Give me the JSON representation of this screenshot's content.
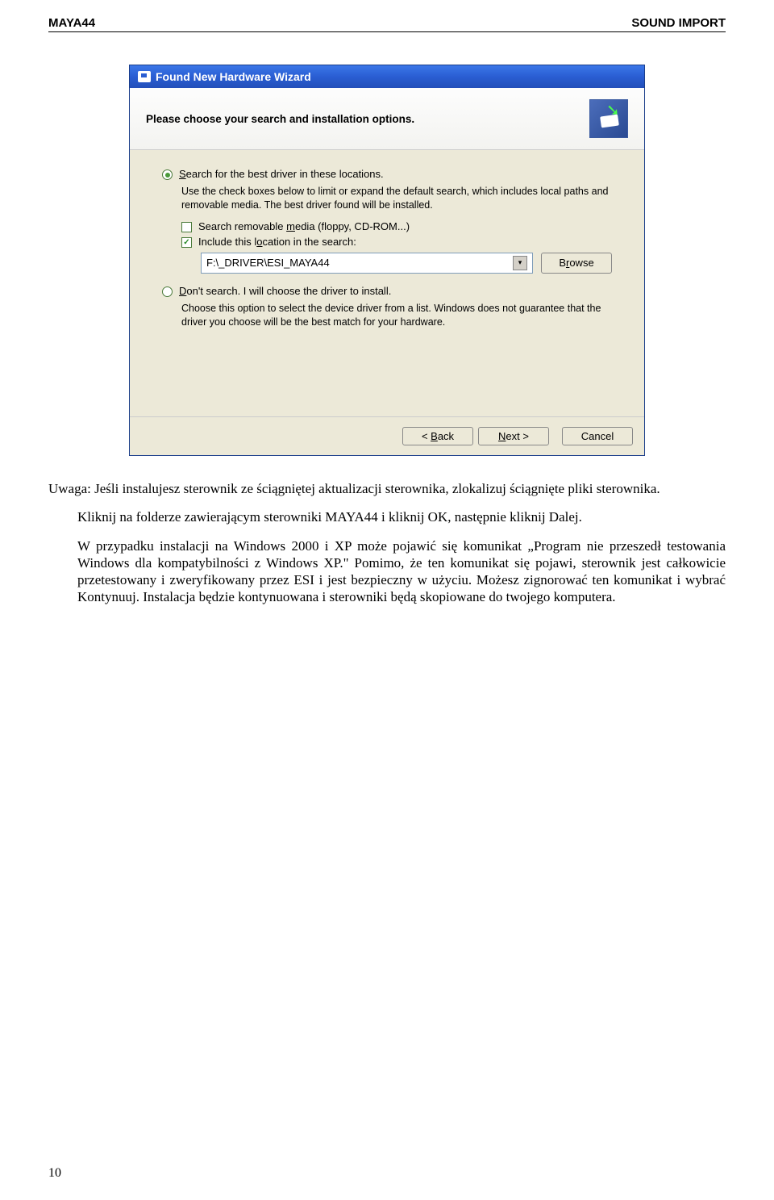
{
  "header": {
    "left": "MAYA44",
    "right": "SOUND IMPORT"
  },
  "wizard": {
    "title": "Found New Hardware Wizard",
    "subtitle": "Please choose your search and installation options.",
    "opt1": {
      "label": "Search for the best driver in these locations.",
      "selected": true,
      "desc": "Use the check boxes below to limit or expand the default search, which includes local paths and removable media. The best driver found will be installed.",
      "chk_media": {
        "label": "Search removable media (floppy, CD-ROM...)",
        "checked": false
      },
      "chk_include": {
        "label": "Include this location in the search:",
        "checked": true
      },
      "path": "F:\\_DRIVER\\ESI_MAYA44",
      "browse": "Browse"
    },
    "opt2": {
      "label": "Don't search. I will choose the driver to install.",
      "selected": false,
      "desc": "Choose this option to select the device driver from a list.  Windows does not guarantee that the driver you choose will be the best match for your hardware."
    },
    "buttons": {
      "back": "< Back",
      "next": "Next >",
      "cancel": "Cancel"
    }
  },
  "body": {
    "p1": "Uwaga: Jeśli instalujesz sterownik ze ściągniętej aktualizacji sterownika, zlokalizuj ściągnięte pliki sterownika.",
    "p2": "Kliknij na folderze zawierającym sterowniki MAYA44 i kliknij OK, następnie kliknij Dalej.",
    "p3": "W przypadku instalacji na Windows 2000 i XP może pojawić się komunikat „Program nie przeszedł testowania Windows dla kompatybilności z Windows XP.\" Pomimo, że ten komunikat się pojawi, sterownik jest całkowicie przetestowany i zweryfikowany przez ESI i jest bezpieczny w użyciu. Możesz zignorować ten komunikat i wybrać Kontynuuj. Instalacja będzie kontynuowana i sterowniki będą skopiowane do twojego komputera."
  },
  "page_number": "10"
}
